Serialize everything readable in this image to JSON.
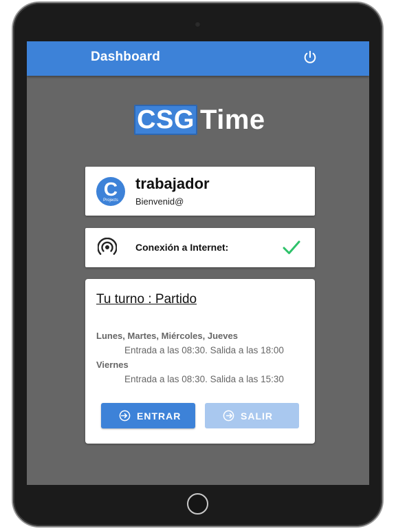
{
  "appbar": {
    "title": "Dashboard",
    "power_icon": "power-icon"
  },
  "logo": {
    "part1": "CSG",
    "part2": "Time"
  },
  "user": {
    "avatar_letter": "C",
    "avatar_sub": "Projects",
    "name": "trabajador",
    "greeting": "Bienvenid@"
  },
  "connection": {
    "label": "Conexión a Internet:",
    "status_icon": "check-icon",
    "status_color": "#2ec26a"
  },
  "shift": {
    "title": "Tu turno : Partido",
    "schedule": [
      {
        "days": "Lunes, Martes, Miércoles, Jueves",
        "hours": "Entrada a las 08:30. Salida a las 18:00"
      },
      {
        "days": "Viernes",
        "hours": "Entrada a las 08:30. Salida a las 15:30"
      }
    ]
  },
  "actions": {
    "enter_label": "ENTRAR",
    "exit_label": "SALIR"
  },
  "colors": {
    "primary": "#3d82d8",
    "disabled": "#a9c8ef",
    "background": "#666666",
    "success": "#2ec26a"
  }
}
